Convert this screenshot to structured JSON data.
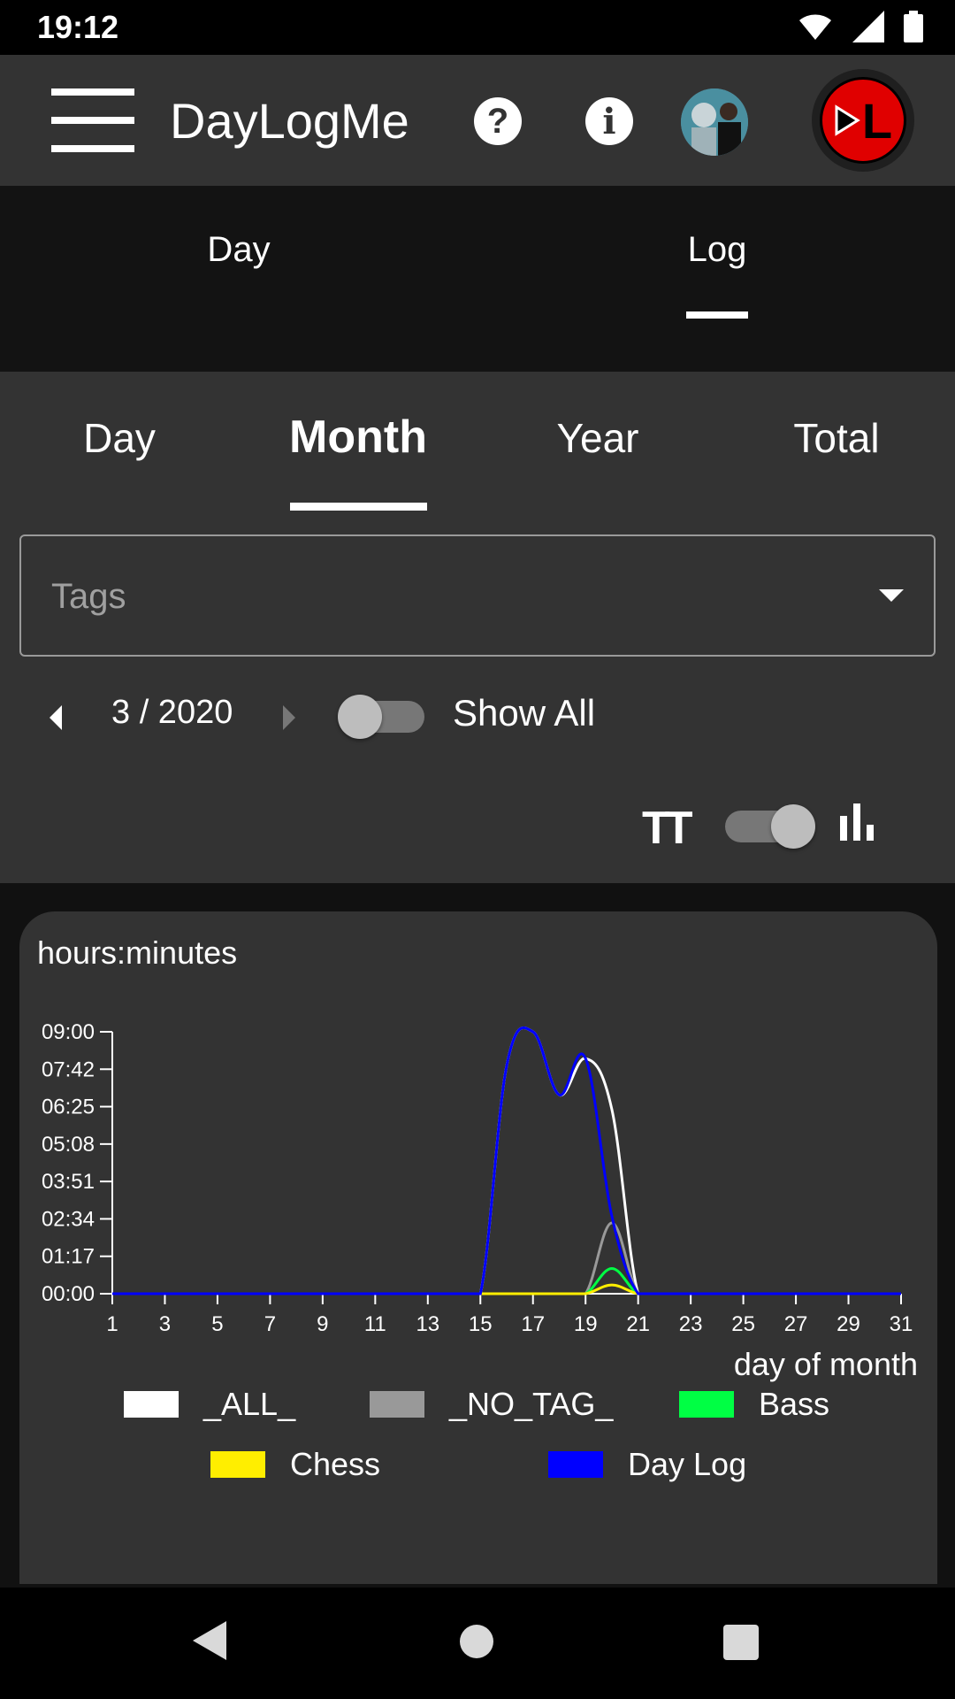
{
  "status": {
    "time": "19:12"
  },
  "appbar": {
    "title": "DayLogMe",
    "help_glyph": "?",
    "info_glyph": "i",
    "logo_text": "L"
  },
  "main_tabs": [
    {
      "label": "Day"
    },
    {
      "label": "Log"
    }
  ],
  "sub_tabs": [
    {
      "label": "Day"
    },
    {
      "label": "Month"
    },
    {
      "label": "Year"
    },
    {
      "label": "Total"
    }
  ],
  "tags": {
    "placeholder": "Tags"
  },
  "month_nav": {
    "value": "3 / 2020",
    "show_all_label": "Show All"
  },
  "view_toggle": {
    "text_size_glyph": "TT"
  },
  "colors": {
    "appbar": "#333333",
    "background": "#111111",
    "all": "#ffffff",
    "no_tag": "#999999",
    "bass": "#00ff44",
    "chess": "#ffee00",
    "day_log": "#0000ff"
  },
  "chart_data": {
    "type": "line",
    "ylabel": "hours:minutes",
    "xlabel": "day of month",
    "x": [
      1,
      2,
      3,
      4,
      5,
      6,
      7,
      8,
      9,
      10,
      11,
      12,
      13,
      14,
      15,
      16,
      17,
      18,
      19,
      20,
      21,
      22,
      23,
      24,
      25,
      26,
      27,
      28,
      29,
      30,
      31
    ],
    "xticks": [
      1,
      3,
      5,
      7,
      9,
      11,
      13,
      15,
      17,
      19,
      21,
      23,
      25,
      27,
      29,
      31
    ],
    "ytick_labels": [
      "00:00",
      "01:17",
      "02:34",
      "03:51",
      "05:08",
      "06:25",
      "07:42",
      "09:00"
    ],
    "ylim_minutes": [
      0,
      540
    ],
    "series": [
      {
        "name": "_ALL_",
        "color": "#ffffff",
        "values": [
          0,
          0,
          0,
          0,
          0,
          0,
          0,
          0,
          0,
          0,
          0,
          0,
          0,
          0,
          0,
          470,
          540,
          410,
          485,
          380,
          0,
          0,
          0,
          0,
          0,
          0,
          0,
          0,
          0,
          0,
          0
        ]
      },
      {
        "name": "_NO_TAG_",
        "color": "#999999",
        "values": [
          0,
          0,
          0,
          0,
          0,
          0,
          0,
          0,
          0,
          0,
          0,
          0,
          0,
          0,
          0,
          0,
          0,
          0,
          0,
          146,
          0,
          0,
          0,
          0,
          0,
          0,
          0,
          0,
          0,
          0,
          0
        ]
      },
      {
        "name": "Bass",
        "color": "#00ff44",
        "values": [
          0,
          0,
          0,
          0,
          0,
          0,
          0,
          0,
          0,
          0,
          0,
          0,
          0,
          0,
          0,
          0,
          0,
          0,
          0,
          52,
          0,
          0,
          0,
          0,
          0,
          0,
          0,
          0,
          0,
          0,
          0
        ]
      },
      {
        "name": "Chess",
        "color": "#ffee00",
        "values": [
          0,
          0,
          0,
          0,
          0,
          0,
          0,
          0,
          0,
          0,
          0,
          0,
          0,
          0,
          0,
          0,
          0,
          0,
          0,
          18,
          0,
          0,
          0,
          0,
          0,
          0,
          0,
          0,
          0,
          0,
          0
        ]
      },
      {
        "name": "Day Log",
        "color": "#0000ff",
        "values": [
          0,
          0,
          0,
          0,
          0,
          0,
          0,
          0,
          0,
          0,
          0,
          0,
          0,
          0,
          0,
          470,
          540,
          410,
          485,
          160,
          0,
          0,
          0,
          0,
          0,
          0,
          0,
          0,
          0,
          0,
          0
        ]
      }
    ]
  }
}
